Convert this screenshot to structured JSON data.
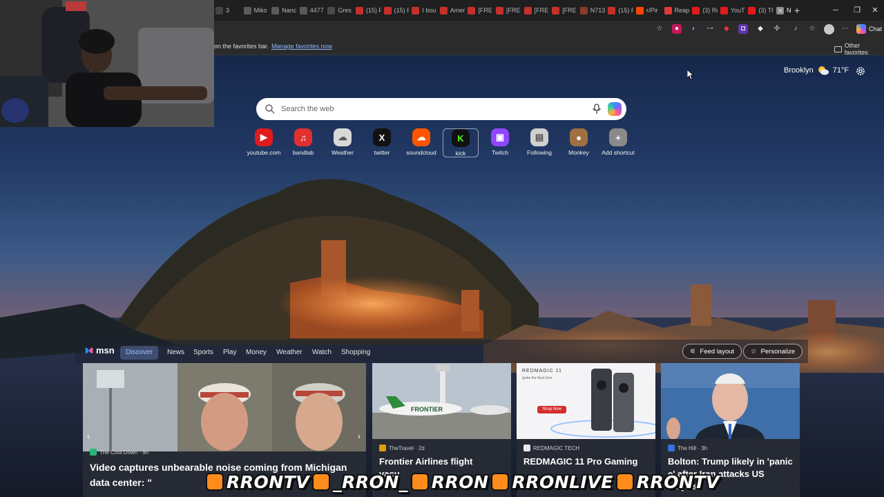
{
  "browser": {
    "tabs": [
      {
        "label": "3",
        "color": "#444"
      },
      {
        "label": "Miko",
        "color": "#5a5a5a"
      },
      {
        "label": "Nanc",
        "color": "#5a5a5a"
      },
      {
        "label": "4477",
        "color": "#5a5a5a"
      },
      {
        "label": "Gres",
        "color": "#4a4a4a"
      },
      {
        "label": "(15) F",
        "color": "#c4302b"
      },
      {
        "label": "(15) F",
        "color": "#c4302b"
      },
      {
        "label": "I bou",
        "color": "#c4302b"
      },
      {
        "label": "Amer",
        "color": "#c4302b"
      },
      {
        "label": "[FRE",
        "color": "#c4302b"
      },
      {
        "label": "[FRE",
        "color": "#c4302b"
      },
      {
        "label": "[FRE",
        "color": "#c4302b"
      },
      {
        "label": "[FRE",
        "color": "#c4302b"
      },
      {
        "label": "N713",
        "color": "#8a3a2a"
      },
      {
        "label": "(15) F",
        "color": "#c4302b"
      },
      {
        "label": "r/Pir",
        "color": "#ff4500"
      },
      {
        "label": "Reap",
        "color": "#e03a3a"
      },
      {
        "label": "(3) Re",
        "color": "#e01b1b"
      },
      {
        "label": "YouT",
        "color": "#e01b1b"
      },
      {
        "label": "(3) Th",
        "color": "#e01b1b"
      },
      {
        "label": "N",
        "color": "#888"
      }
    ],
    "new_tab_label": "+",
    "copilot_label": "Chat",
    "favbar_text": "on the favorites bar.",
    "favbar_link": "Manage favorites now",
    "other_favorites": "Other favorites"
  },
  "weather": {
    "city": "Brooklyn",
    "temp": "71°F"
  },
  "search": {
    "placeholder": "Search the web"
  },
  "shortcuts": [
    {
      "label": "youtube.com",
      "glyph": "▶",
      "color": "#e01b1b"
    },
    {
      "label": "bandlab",
      "glyph": "♫",
      "color": "#e03030"
    },
    {
      "label": "Weather",
      "glyph": "☁",
      "color": "#d9d9d9"
    },
    {
      "label": "twitter",
      "glyph": "X",
      "color": "#111111"
    },
    {
      "label": "soundcloud",
      "glyph": "☁",
      "color": "#ff5500"
    },
    {
      "label": "kick",
      "glyph": "K",
      "color": "#111111"
    },
    {
      "label": "Twitch",
      "glyph": "▣",
      "color": "#9146ff"
    },
    {
      "label": "Following",
      "glyph": "▤",
      "color": "#cfcfcf"
    },
    {
      "label": "Monkey",
      "glyph": "●",
      "color": "#a07040"
    },
    {
      "label": "Add shortcut",
      "glyph": "+",
      "color": "#8a8a8a"
    }
  ],
  "feed": {
    "logo": "msn",
    "tabs": [
      "Discover",
      "News",
      "Sports",
      "Play",
      "Money",
      "Weather",
      "Watch",
      "Shopping"
    ],
    "active_tab": "Discover",
    "feed_layout": "Feed layout",
    "personalize": "Personalize",
    "cards": [
      {
        "source": "The Cool Down · 9h",
        "title": "Video captures unbearable noise coming from Michigan data center: \"",
        "logo_color": "#2bb673"
      },
      {
        "source": "TheTravel · 2d",
        "title": "Frontier Airlines flight",
        "logo_color": "#e0a000",
        "sub": "vacu"
      },
      {
        "source": "REDMAGIC TECH",
        "title": "REDMAGIC 11 Pro Gaming",
        "logo_color": "#e8e8e8",
        "ad_brand": "REDMAGIC 11",
        "ad_tagline": "Ignite the Next-Gen",
        "ad_button": "Shop Now"
      },
      {
        "source": "The Hill · 3h",
        "title": "Bolton: Trump likely in 'panic",
        "title2": "e' after Iran attacks US",
        "title3": "ter jets",
        "logo_color": "#3a6fd8"
      }
    ]
  },
  "overlay": {
    "handles": [
      "RRONTV",
      "_RRON_",
      "RRON",
      "RRONLIVE",
      "RRONTV"
    ]
  }
}
